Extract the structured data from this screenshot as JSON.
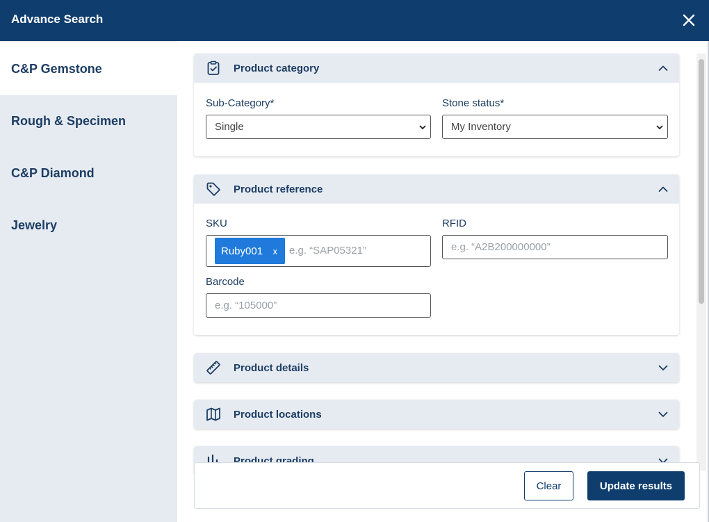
{
  "header": {
    "title": "Advance Search",
    "close_icon": "close-icon"
  },
  "sidebar": {
    "items": [
      {
        "label": "C&P Gemstone",
        "active": true
      },
      {
        "label": "Rough & Specimen",
        "active": false
      },
      {
        "label": "C&P Diamond",
        "active": false
      },
      {
        "label": "Jewelry",
        "active": false
      }
    ]
  },
  "sections": {
    "category": {
      "title": "Product category",
      "icon": "clipboard-check-icon",
      "expanded": true,
      "sub_category": {
        "label": "Sub-Category*",
        "value": "Single"
      },
      "stone_status": {
        "label": "Stone status*",
        "value": "My Inventory"
      }
    },
    "reference": {
      "title": "Product reference",
      "icon": "tag-icon",
      "expanded": true,
      "sku": {
        "label": "SKU",
        "tag": "Ruby001",
        "tag_remove": "x",
        "placeholder": "e.g. “SAP05321”"
      },
      "rfid": {
        "label": "RFID",
        "placeholder": "e.g. “A2B200000000”"
      },
      "barcode": {
        "label": "Barcode",
        "placeholder": "e.g. “105000”"
      }
    },
    "details": {
      "title": "Product details",
      "icon": "ruler-icon",
      "expanded": false
    },
    "locations": {
      "title": "Product locations",
      "icon": "map-icon",
      "expanded": false
    },
    "grading": {
      "title": "Product grading",
      "icon": "grading-icon",
      "expanded": false
    }
  },
  "footer": {
    "clear_label": "Clear",
    "update_label": "Update results"
  },
  "colors": {
    "header": "#0e3d6e",
    "sidebar": "#e6ebf2",
    "tag": "#1f7adb",
    "text": "#1d3d63"
  }
}
